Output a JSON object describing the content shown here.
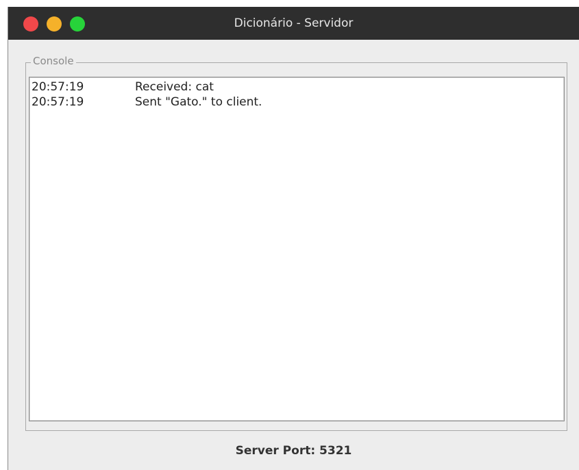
{
  "window": {
    "title": "Dicionário - Servidor",
    "controls": {
      "close_color": "#f0484a",
      "minimize_color": "#f5b12a",
      "maximize_color": "#27d33a"
    }
  },
  "console": {
    "legend": "Console",
    "lines": [
      {
        "time": "20:57:19",
        "message": "Received: cat"
      },
      {
        "time": "20:57:19",
        "message": "Sent \"Gato.\" to client."
      }
    ]
  },
  "footer": {
    "server_port_label": "Server Port: 5321"
  }
}
